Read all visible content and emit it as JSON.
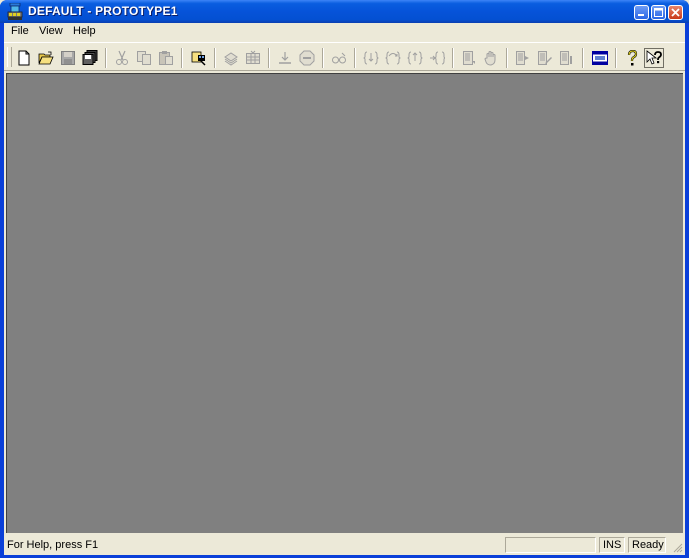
{
  "window": {
    "title": "DEFAULT - PROTOTYPE1",
    "title_bar_color": "#0653d9",
    "controls": [
      "minimize-icon",
      "maximize-icon",
      "close-icon"
    ]
  },
  "menubar": {
    "items": [
      {
        "label": "File"
      },
      {
        "label": "View"
      },
      {
        "label": "Help"
      }
    ]
  },
  "toolbar": {
    "buttons": [
      {
        "name": "new-document-icon",
        "enabled": true
      },
      {
        "name": "open-folder-icon",
        "enabled": true
      },
      {
        "name": "save-icon",
        "enabled": false
      },
      {
        "name": "save-all-icon",
        "enabled": true
      },
      {
        "name": "cut-icon",
        "enabled": false
      },
      {
        "name": "copy-icon",
        "enabled": false
      },
      {
        "name": "paste-icon",
        "enabled": false
      },
      {
        "name": "find-icon",
        "enabled": true
      },
      {
        "name": "layers-icon",
        "enabled": false
      },
      {
        "name": "grid-icon",
        "enabled": false
      },
      {
        "name": "download-icon",
        "enabled": false
      },
      {
        "name": "stop-icon",
        "enabled": false
      },
      {
        "name": "watch-icon",
        "enabled": false
      },
      {
        "name": "step-into-icon",
        "enabled": false
      },
      {
        "name": "step-over-icon",
        "enabled": false
      },
      {
        "name": "step-out-icon",
        "enabled": false
      },
      {
        "name": "run-to-cursor-icon",
        "enabled": false
      },
      {
        "name": "insert-breakpoint-icon",
        "enabled": false
      },
      {
        "name": "hand-icon",
        "enabled": false
      },
      {
        "name": "export-icon",
        "enabled": false
      },
      {
        "name": "edit-list-icon",
        "enabled": false
      },
      {
        "name": "list-icon",
        "enabled": false
      },
      {
        "name": "window-view-icon",
        "enabled": true,
        "pressed": true
      },
      {
        "name": "help-icon",
        "enabled": true
      },
      {
        "name": "context-help-icon",
        "enabled": true
      }
    ]
  },
  "workspace": {
    "background": "#808080"
  },
  "statusbar": {
    "message": "For Help, press F1",
    "pane_ins": "INS",
    "pane_ready": "Ready"
  }
}
